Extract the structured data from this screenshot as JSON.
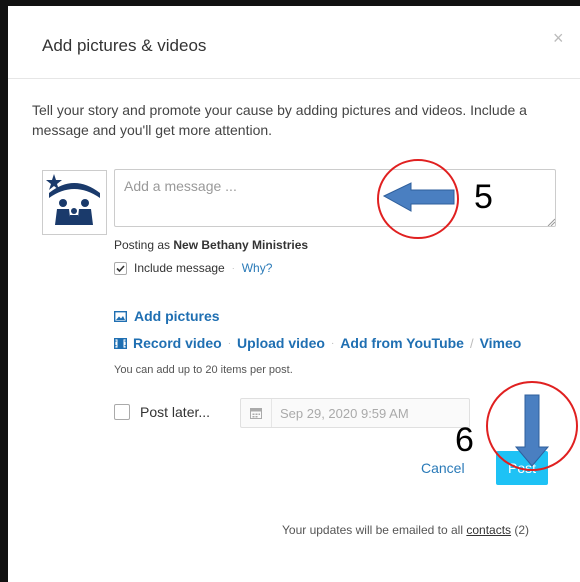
{
  "dialog": {
    "title": "Add pictures & videos",
    "close_label": "×",
    "intro": "Tell your story and promote your cause by adding pictures and videos. Include a message and you'll get more attention."
  },
  "message": {
    "placeholder": "Add a message ...",
    "value": ""
  },
  "posting_as": {
    "prefix": "Posting as ",
    "name": "New Bethany Ministries"
  },
  "include_message": {
    "label": "Include message",
    "checked": true,
    "separator": "·",
    "why_link": "Why?"
  },
  "media_links": {
    "add_pictures": "Add pictures",
    "record_video": "Record video",
    "upload_video": "Upload video",
    "add_from_youtube": "Add from YouTube",
    "slash": "/",
    "vimeo": "Vimeo",
    "separator": "·",
    "limit_hint": "You can add up to 20 items per post."
  },
  "schedule": {
    "post_later_label": "Post later...",
    "post_later_checked": false,
    "date_value": "Sep 29, 2020 9:59 AM"
  },
  "actions": {
    "cancel": "Cancel",
    "post": "Post"
  },
  "footer": {
    "text": "Your updates will be emailed to all ",
    "link": "contacts",
    "count": " (2)"
  },
  "annotations": {
    "step_a": "5",
    "step_b": "6"
  },
  "colors": {
    "link": "#1f6fb2",
    "post_button": "#1ec2f5",
    "annotation_circle": "#e02020",
    "annotation_arrow": "#4a7fc1"
  }
}
